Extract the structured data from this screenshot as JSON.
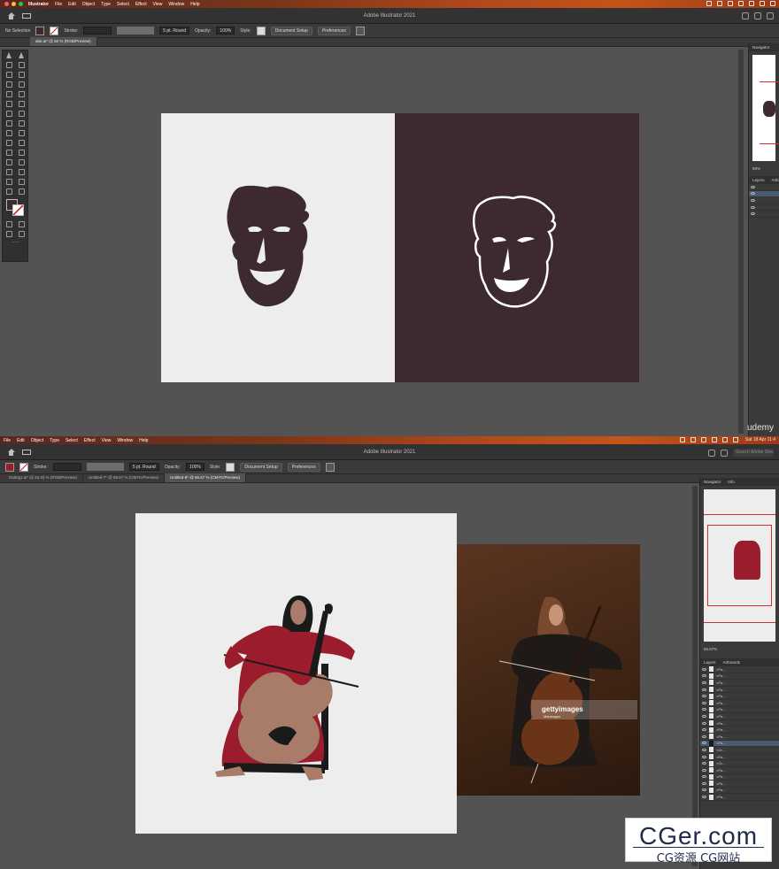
{
  "top": {
    "menubar": {
      "app": "Illustrator",
      "items": [
        "File",
        "Edit",
        "Object",
        "Type",
        "Select",
        "Effect",
        "View",
        "Window",
        "Help"
      ]
    },
    "title": "Adobe Illustrator 2021",
    "control": {
      "selection": "No Selection",
      "stroke_label": "Stroke:",
      "brush": "5 pt. Round",
      "opacity_label": "Opacity:",
      "opacity": "100%",
      "style_label": "Style:",
      "doc_setup": "Document Setup",
      "preferences": "Preferences"
    },
    "tabs": [
      "abe.ai* @ 50 % (RGB/Preview)"
    ],
    "navigator": {
      "title": "Navigator",
      "zoom": "50%"
    },
    "layers": {
      "tab1": "Layers",
      "tab2": "Artb"
    }
  },
  "bottom": {
    "menubar": {
      "items": [
        "File",
        "Edit",
        "Object",
        "Type",
        "Select",
        "Effect",
        "View",
        "Window",
        "Help"
      ],
      "clock": "Sat 18 Apr 11:4"
    },
    "title": "Adobe Illustrator 2021",
    "search_placeholder": "Search Adobe Stock",
    "control": {
      "stroke_label": "Stroke:",
      "brush": "5 pt. Round",
      "opacity_label": "Opacity:",
      "opacity": "100%",
      "style_label": "Style:",
      "doc_setup": "Document Setup",
      "preferences": "Preferences"
    },
    "tabs": [
      "Dating1.ai* @ 33.33 % (RGB/Preview)",
      "Untitled-7* @ 66.67 % (CMYK/Preview)",
      "Untitled-8* @ 66.67 % (CMYK/Preview)"
    ],
    "navigator": {
      "title": "Navigator",
      "info": "Info",
      "zoom": "66.67%"
    },
    "layers": {
      "tab1": "Layers",
      "tab2": "Artboards"
    },
    "layer_items": [
      "<Pa...",
      "<Pa...",
      "<Pa...",
      "<Pa...",
      "<Pa...",
      "<Pa...",
      "<Pa...",
      "<Pa...",
      "<Pa...",
      "<Pa...",
      "<Pa...",
      "<Pa...",
      "<Gr...",
      "<Pa...",
      "<Gr...",
      "<Pa...",
      "<Pa...",
      "<Pa...",
      "<Pa...",
      "<Pa..."
    ],
    "stock_photo": {
      "brand": "gettyimages",
      "credit": "Marmagan"
    }
  },
  "watermark": {
    "main": "CGer.com",
    "sub": "CG资源 CG网站"
  },
  "udemy": "udemy",
  "colors": {
    "abe_dark": "#3c2a2e",
    "artboard_light": "#ededed",
    "dress_red": "#9b1c2c",
    "skin": "#a97c6a"
  }
}
